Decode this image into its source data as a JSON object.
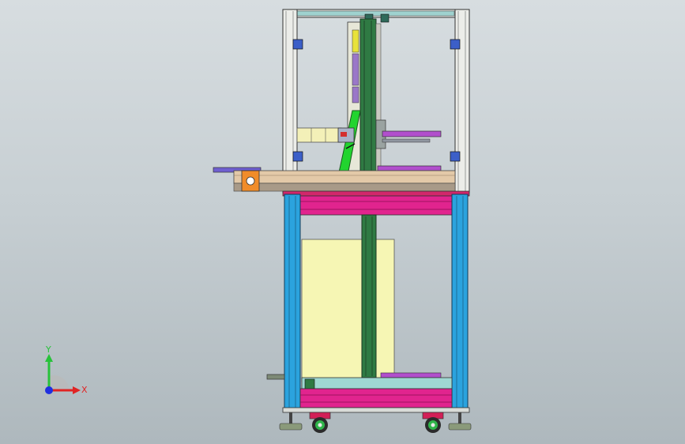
{
  "viewport": {
    "background_top": "#d7dde0",
    "background_bottom": "#aeb8bd"
  },
  "model": {
    "description_colors": {
      "upper_frame": "#e9ebe6",
      "lower_frame": "#2ba3de",
      "magenta_beam": "#e1248e",
      "column_green": "#2f7a43",
      "arm_green": "#22d42f",
      "panel_yellow": "#f6f6b4",
      "wheel_red": "#d21f57"
    }
  },
  "triad": {
    "x_label": "X",
    "y_label": "Y",
    "x_color": "#e02424",
    "y_color": "#27c23a",
    "z_color": "#1f2fe0"
  }
}
